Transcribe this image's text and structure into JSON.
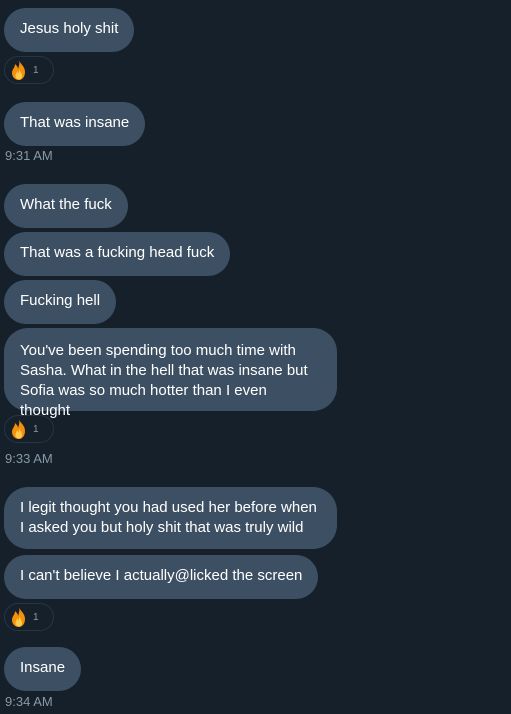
{
  "messages": [
    {
      "text": "Jesus holy shit"
    },
    {
      "text": "That was insane"
    },
    {
      "text": "What the fuck"
    },
    {
      "text": "That was a fucking head fuck"
    },
    {
      "text": "Fucking hell"
    },
    {
      "text": "You've been spending too much time with Sasha. What in the hell that was insane but Sofia was so much hotter than I even thought"
    },
    {
      "text": "I legit thought you had used her before when I asked you but holy shit that was truly wild"
    },
    {
      "text": "I can't believe I actually@licked the screen"
    },
    {
      "text": "Insane"
    }
  ],
  "reactions": [
    {
      "icon": "fire-icon",
      "count": "1"
    },
    {
      "icon": "fire-icon",
      "count": "1"
    },
    {
      "icon": "fire-icon",
      "count": "1"
    }
  ],
  "timestamps": [
    "9:31 AM",
    "9:33 AM",
    "9:34 AM"
  ],
  "colors": {
    "background": "#15202b",
    "bubble": "#3d4f62",
    "muted_text": "#8899a6"
  }
}
